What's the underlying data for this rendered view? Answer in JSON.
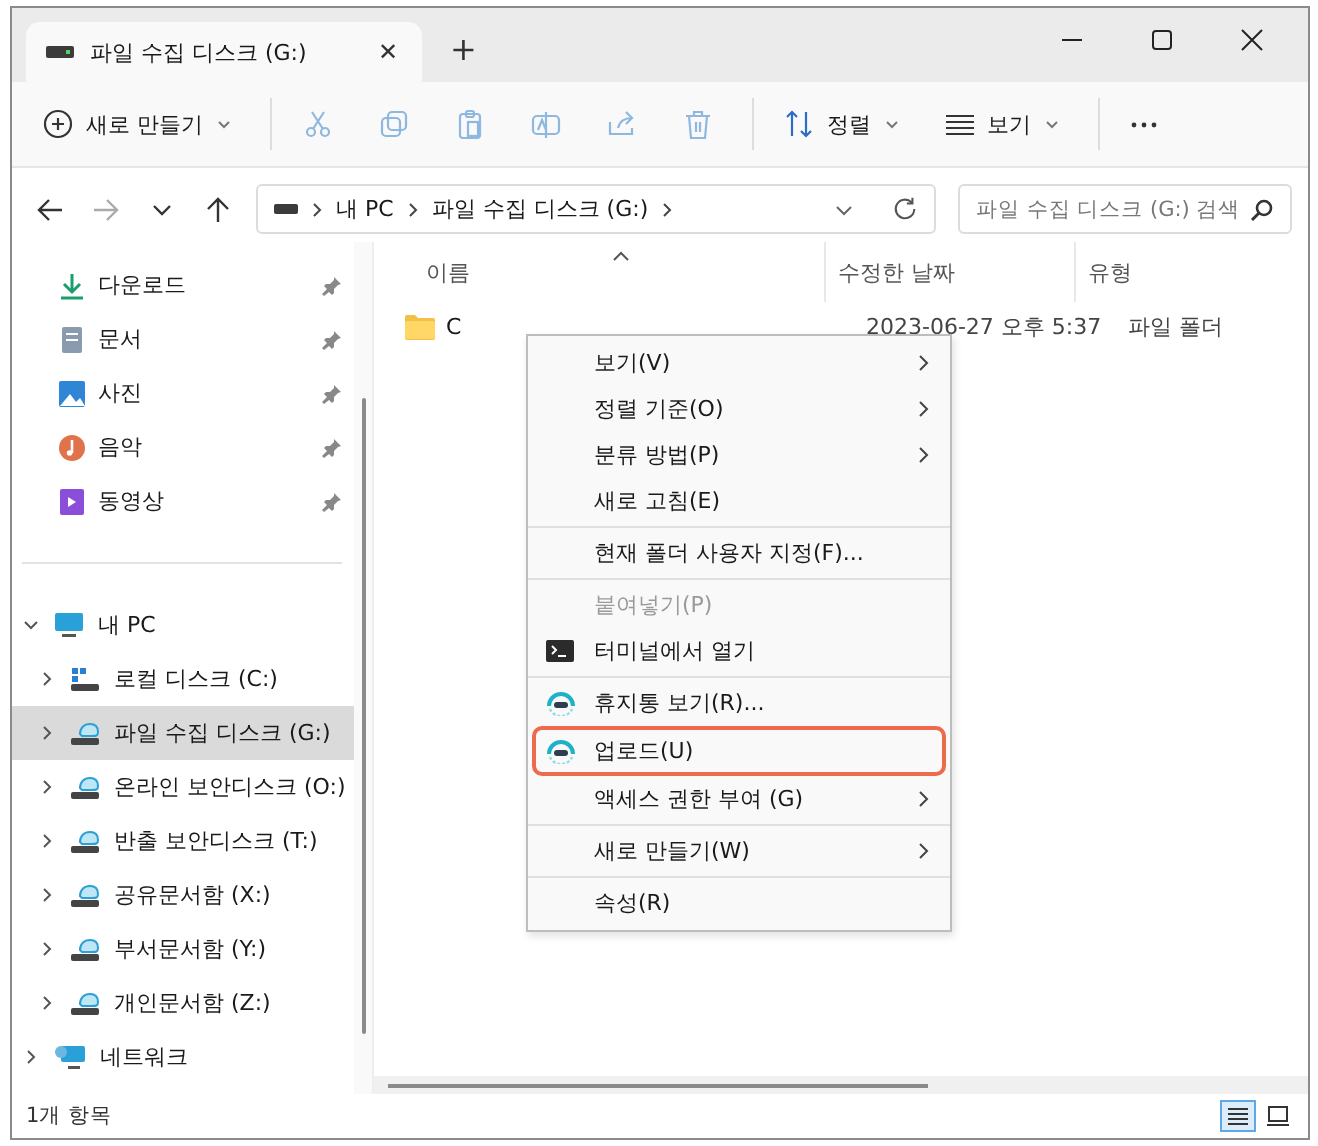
{
  "tab": {
    "title": "파일 수집 디스크 (G:)",
    "close": "✕",
    "new_tab": "+"
  },
  "toolbar": [
    {
      "kind": "new",
      "label": "새로 만들기",
      "dropdown": true,
      "disabled": false
    },
    {
      "kind": "cut",
      "disabled": true
    },
    {
      "kind": "copy",
      "disabled": true
    },
    {
      "kind": "paste",
      "disabled": true
    },
    {
      "kind": "rename",
      "disabled": true
    },
    {
      "kind": "share",
      "disabled": true
    },
    {
      "kind": "delete",
      "disabled": true
    },
    {
      "kind": "sort",
      "label": "정렬",
      "dropdown": true,
      "disabled": false
    },
    {
      "kind": "view",
      "label": "보기",
      "dropdown": true,
      "disabled": false
    },
    {
      "kind": "more",
      "disabled": false
    }
  ],
  "nav": [
    {
      "kind": "back",
      "disabled": false
    },
    {
      "kind": "forward",
      "disabled": true
    },
    {
      "kind": "recent",
      "disabled": false
    },
    {
      "kind": "up",
      "disabled": false
    }
  ],
  "address": {
    "segments": [
      "내 PC",
      "파일 수집 디스크 (G:)"
    ]
  },
  "search": {
    "placeholder": "파일 수집 디스크 (G:) 검색"
  },
  "quick_access": [
    {
      "label": "다운로드",
      "kind": "download",
      "pinned": true
    },
    {
      "label": "문서",
      "kind": "document",
      "pinned": true
    },
    {
      "label": "사진",
      "kind": "picture",
      "pinned": true
    },
    {
      "label": "음악",
      "kind": "music",
      "pinned": true
    },
    {
      "label": "동영상",
      "kind": "video",
      "pinned": true
    }
  ],
  "tree": [
    {
      "label": "내 PC",
      "kind": "pc",
      "expanded": true,
      "selected": false,
      "children": [
        {
          "label": "로컬 디스크 (C:)",
          "kind": "system-drive",
          "expanded": false,
          "selected": false
        },
        {
          "label": "파일 수집 디스크 (G:)",
          "kind": "net-drive",
          "expanded": false,
          "selected": true
        },
        {
          "label": "온라인 보안디스크 (O:)",
          "kind": "net-drive",
          "expanded": false,
          "selected": false
        },
        {
          "label": "반출 보안디스크 (T:)",
          "kind": "net-drive",
          "expanded": false,
          "selected": false
        },
        {
          "label": "공유문서함 (X:)",
          "kind": "net-drive",
          "expanded": false,
          "selected": false
        },
        {
          "label": "부서문서함 (Y:)",
          "kind": "net-drive",
          "expanded": false,
          "selected": false
        },
        {
          "label": "개인문서함 (Z:)",
          "kind": "net-drive",
          "expanded": false,
          "selected": false
        }
      ]
    },
    {
      "label": "네트워크",
      "kind": "network",
      "expanded": false,
      "selected": false
    }
  ],
  "table": {
    "columns": [
      "이름",
      "수정한 날짜",
      "유형"
    ],
    "rows": [
      {
        "name": "C",
        "modified": "2023-06-27 오후 5:37",
        "type": "파일 폴더"
      }
    ]
  },
  "context_menu": {
    "groups": [
      [
        {
          "label": "보기(V)",
          "submenu": true,
          "disabled": false,
          "selected": false
        },
        {
          "label": "정렬 기준(O)",
          "submenu": true,
          "disabled": false,
          "selected": false
        },
        {
          "label": "분류 방법(P)",
          "submenu": true,
          "disabled": false,
          "selected": false
        },
        {
          "label": "새로 고침(E)",
          "submenu": false,
          "disabled": false,
          "selected": false
        }
      ],
      [
        {
          "label": "현재 폴더 사용자 지정(F)...",
          "submenu": false,
          "disabled": false,
          "selected": false
        }
      ],
      [
        {
          "label": "붙여넣기(P)",
          "submenu": false,
          "disabled": true,
          "selected": false
        },
        {
          "label": "터미널에서 열기",
          "kind": "terminal",
          "submenu": false,
          "disabled": false,
          "selected": false
        }
      ],
      [
        {
          "label": "휴지통 보기(R)...",
          "kind": "app",
          "submenu": false,
          "disabled": false,
          "selected": false
        },
        {
          "label": "업로드(U)",
          "kind": "app",
          "submenu": false,
          "disabled": false,
          "selected": true
        },
        {
          "label": "액세스 권한 부여 (G)",
          "submenu": true,
          "disabled": false,
          "selected": false
        }
      ],
      [
        {
          "label": "새로 만들기(W)",
          "submenu": true,
          "disabled": false,
          "selected": false
        }
      ],
      [
        {
          "label": "속성(R)",
          "submenu": false,
          "disabled": false,
          "selected": false
        }
      ]
    ]
  },
  "status_bar": {
    "text": "1개 항목",
    "views": [
      {
        "kind": "details",
        "selected": true
      },
      {
        "kind": "tiles",
        "selected": false
      }
    ]
  }
}
